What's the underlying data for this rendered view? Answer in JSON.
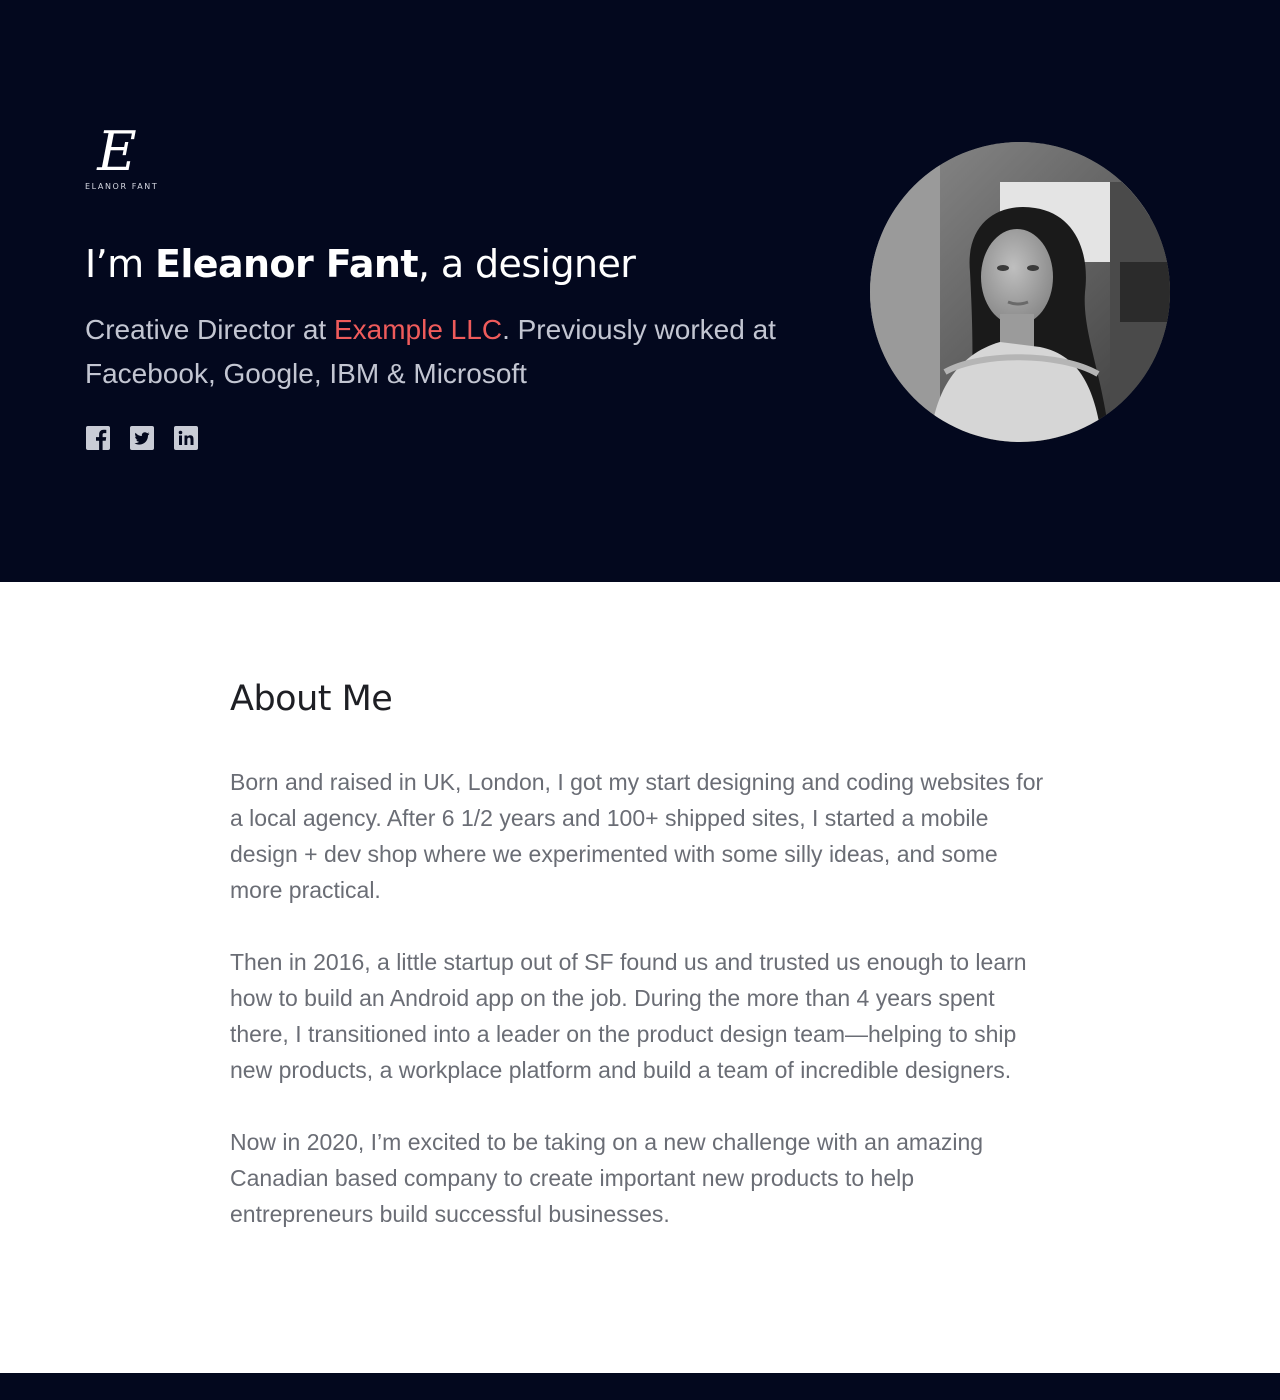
{
  "brand": {
    "logo_letter": "E",
    "logo_text": "ELANOR FANT"
  },
  "hero": {
    "headline_prefix": "I’m ",
    "headline_name": "Eleanor Fant",
    "headline_suffix": ", a designer",
    "subtitle_prefix": "Creative Director at ",
    "subtitle_company": "Example LLC",
    "subtitle_suffix": ". Previously worked at Facebook, Google, IBM & Microsoft",
    "socials": [
      {
        "icon": "facebook-icon"
      },
      {
        "icon": "twitter-icon"
      },
      {
        "icon": "linkedin-icon"
      }
    ],
    "avatar": {
      "icon": "profile-photo"
    }
  },
  "about": {
    "title": "About Me",
    "paragraphs": [
      "Born and raised in UK, London, I got my start designing and coding websites for a local agency. After 6 1/2 years and 100+ shipped sites, I started a mobile design + dev shop where we experimented with some silly ideas, and some more practical.",
      "Then in 2016, a little startup out of SF found us and trusted us enough to learn how to build an Android app on the job. During the more than 4 years spent there, I transitioned into a leader on the product design team—helping to ship new products, a workplace platform and build a team of incredible designers.",
      "Now in 2020, I’m excited to be taking on a new challenge with an amazing Canadian based company to create important new products to help entrepreneurs build successful businesses."
    ]
  },
  "colors": {
    "hero_background": "#03081e",
    "accent": "#ef5b5b",
    "heading_text": "#1e1f24",
    "body_text": "#6a6d75",
    "subtitle_text": "#c3c6d2"
  }
}
